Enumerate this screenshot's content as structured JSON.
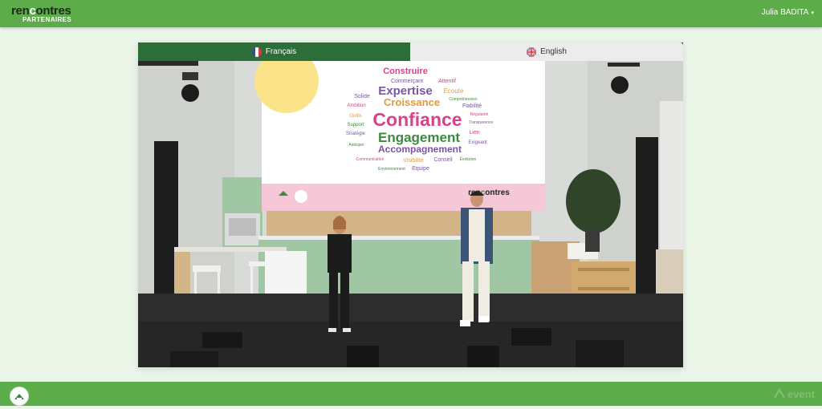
{
  "header": {
    "logo_main_a": "ren",
    "logo_main_o": "c",
    "logo_main_b": "ontres",
    "logo_sub": "PARTENAIRES",
    "user_name": "Julia BADITA",
    "user_caret": "▾"
  },
  "player": {
    "tabs": [
      {
        "label": "Français",
        "active": true,
        "flag": "french-flag-icon"
      },
      {
        "label": "English",
        "active": false,
        "flag": "uk-flag-icon"
      }
    ]
  },
  "stage_screen": {
    "words": [
      "Construire",
      "Commerçant",
      "Attentif",
      "Expertise",
      "Ecoute",
      "Solide",
      "Compréhension",
      "Ambition",
      "Croissance",
      "Fiabilité",
      "Outils",
      "Régularité",
      "Confiance",
      "Transparence",
      "Support",
      "Lien",
      "Stratégie",
      "Engagement",
      "Exigeant",
      "Anticiper",
      "Accompagnement",
      "Communication",
      "Visibilité",
      "Conseil",
      "Évolution",
      "Environnement",
      "Equipe"
    ],
    "footer_logo_a": "ren",
    "footer_logo_o": "c",
    "footer_logo_b": "ontres"
  },
  "footer": {
    "brand": "event",
    "home_icon": "home-logo-icon"
  },
  "colors": {
    "bar_green": "#5cac4a",
    "tab_active": "#2d6e38",
    "page_bg": "#eaf5e8"
  }
}
